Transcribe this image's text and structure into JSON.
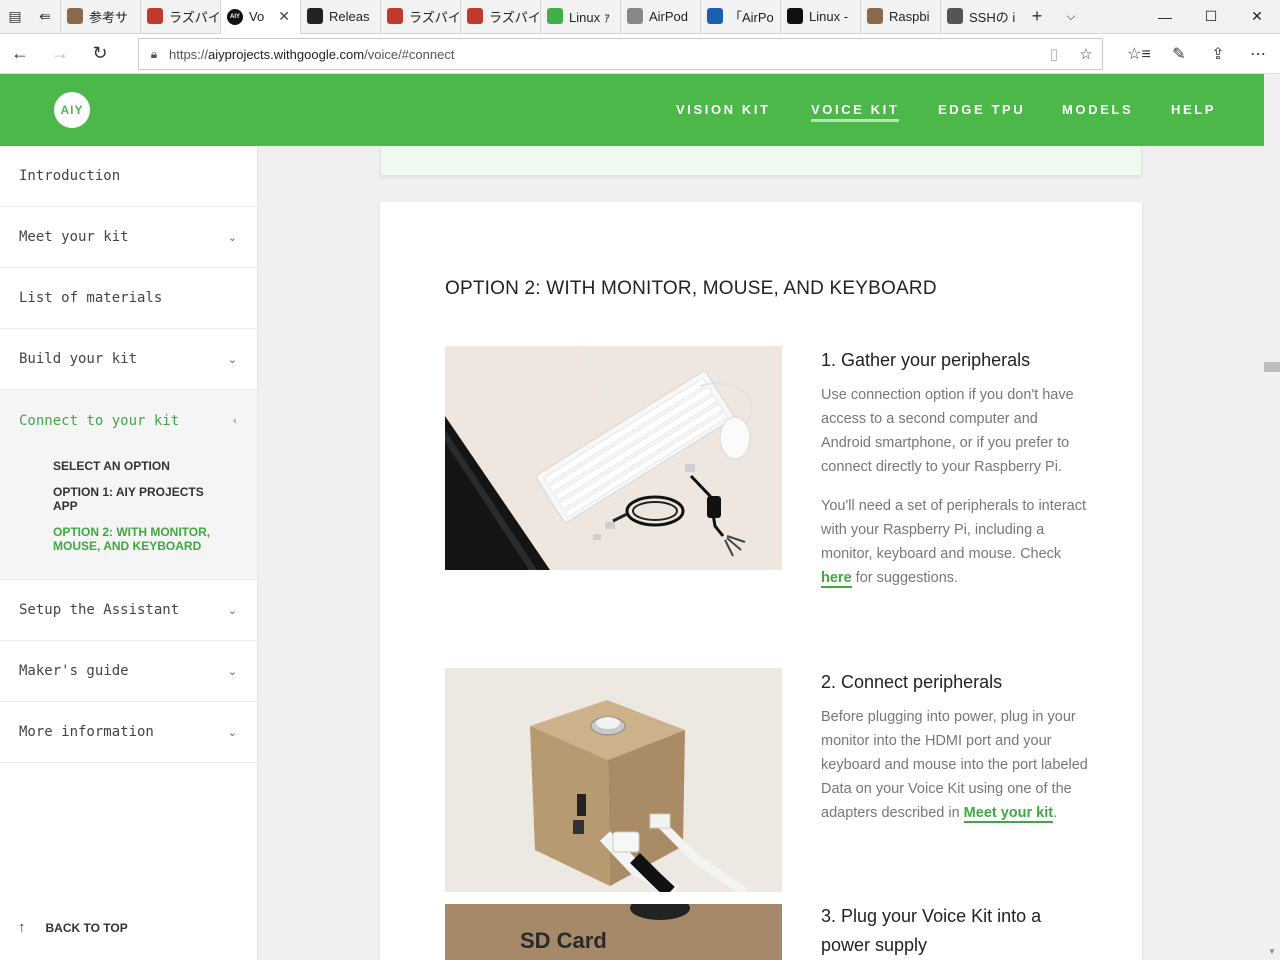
{
  "browser": {
    "tabs": [
      {
        "label": "参考サ",
        "color": "#8a6a4a"
      },
      {
        "label": "ラズパイ",
        "color": "#c0392b"
      },
      {
        "label": "Vo",
        "color": "#111111",
        "active": true
      },
      {
        "label": "Releas",
        "color": "#222222"
      },
      {
        "label": "ラズパイ",
        "color": "#c0392b"
      },
      {
        "label": "ラズパイ",
        "color": "#c0392b"
      },
      {
        "label": "Linux ｧ",
        "color": "#3fae49"
      },
      {
        "label": "AirPod",
        "color": "#888888"
      },
      {
        "label": "「AirPo",
        "color": "#1a5fb4"
      },
      {
        "label": "Linux -",
        "color": "#111111"
      },
      {
        "label": "Raspbi",
        "color": "#8a6a4a"
      },
      {
        "label": "SSHの i",
        "color": "#555555"
      }
    ],
    "active_favicon_text": "AIY",
    "url_prefix": "https://",
    "url_host": "aiyprojects.withgoogle.com",
    "url_path": "/voice/#connect"
  },
  "header": {
    "logo": "AIY",
    "nav": [
      "VISION KIT",
      "VOICE KIT",
      "EDGE TPU",
      "MODELS",
      "HELP"
    ],
    "active_nav": "VOICE KIT"
  },
  "sidebar": {
    "items": [
      {
        "label": "Introduction",
        "chevron": false
      },
      {
        "label": "Meet your kit",
        "chevron": true
      },
      {
        "label": "List of materials",
        "chevron": false
      },
      {
        "label": "Build your kit",
        "chevron": true
      },
      {
        "label": "Connect to your kit",
        "chevron": true,
        "active": true
      },
      {
        "label": "Setup the Assistant",
        "chevron": true
      },
      {
        "label": "Maker's guide",
        "chevron": true
      },
      {
        "label": "More information",
        "chevron": true
      }
    ],
    "subitems": [
      "SELECT AN OPTION",
      "OPTION 1: AIY PROJECTS APP",
      "OPTION 2: WITH MONITOR, MOUSE, AND KEYBOARD"
    ],
    "back_to_top": "BACK TO TOP"
  },
  "content": {
    "heading": "OPTION 2: WITH MONITOR, MOUSE, AND KEYBOARD",
    "step1": {
      "title": "1. Gather your peripherals",
      "p1": "Use connection option if you don't have access to a second computer and Android smartphone, or if you prefer to connect directly to your Raspberry Pi.",
      "p2_before": "You'll need a set of peripherals to interact with your Raspberry Pi, including a monitor, keyboard and mouse. Check ",
      "p2_link": "here",
      "p2_after": " for suggestions."
    },
    "step2": {
      "title": "2. Connect peripherals",
      "p1_before": "Before plugging into power, plug in your monitor into the HDMI port and your keyboard and mouse into the port labeled Data on your Voice Kit using one of the adapters described in ",
      "p1_link": "Meet your kit",
      "p1_after": "."
    },
    "step3": {
      "title": "3. Plug your Voice Kit into a power supply",
      "image_text": "SD Card"
    }
  }
}
